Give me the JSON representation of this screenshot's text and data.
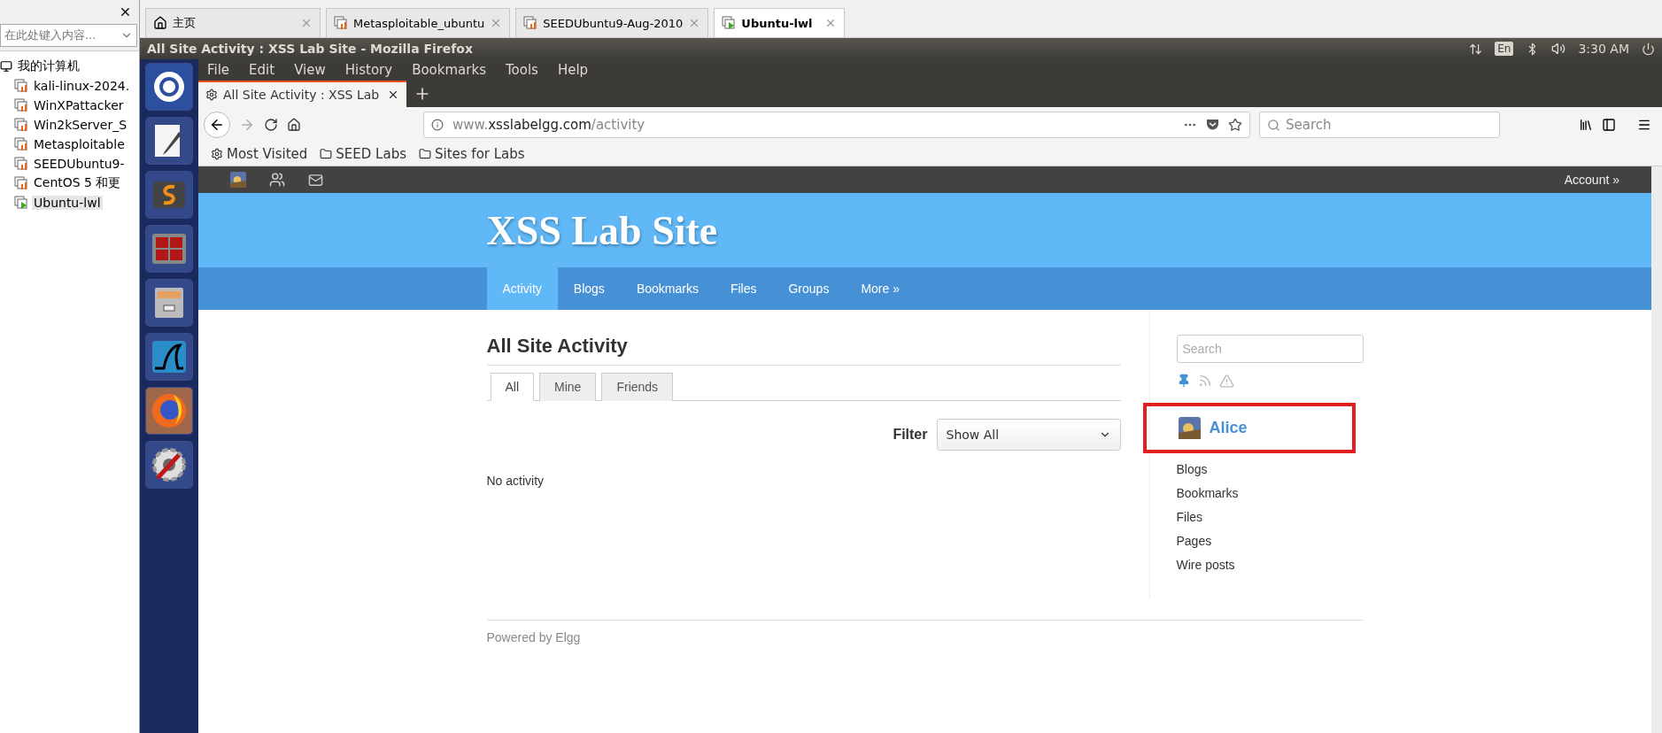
{
  "host_pane": {
    "search": {
      "placeholder": "在此处键入内容..."
    },
    "tree": [
      {
        "label": "我的计算机",
        "kind": "computer",
        "selected": false,
        "children": [
          {
            "label": "kali-linux-2024.",
            "kind": "vm",
            "running": false,
            "selected": false
          },
          {
            "label": "WinXPattacker",
            "kind": "vm",
            "running": false,
            "selected": false
          },
          {
            "label": "Win2kServer_S",
            "kind": "vm",
            "running": false,
            "selected": false
          },
          {
            "label": "Metasploitable",
            "kind": "vm",
            "running": false,
            "selected": false
          },
          {
            "label": "SEEDUbuntu9-",
            "kind": "vm",
            "running": false,
            "selected": false
          },
          {
            "label": "CentOS 5 和更",
            "kind": "vm",
            "running": false,
            "selected": false
          },
          {
            "label": "Ubuntu-lwl",
            "kind": "vm",
            "running": true,
            "selected": true
          }
        ]
      }
    ]
  },
  "vm_tabs": [
    {
      "label": "主页",
      "kind": "home",
      "selected": false
    },
    {
      "label": "Metasploitable_ubuntu",
      "kind": "vm",
      "running": false,
      "selected": false
    },
    {
      "label": "SEEDUbuntu9-Aug-2010",
      "kind": "vm",
      "running": false,
      "selected": false
    },
    {
      "label": "Ubuntu-lwl",
      "kind": "vm",
      "running": true,
      "selected": true
    }
  ],
  "top_panel": {
    "title": "All Site Activity : XSS Lab Site - Mozilla Firefox",
    "keyboard": "En",
    "clock": "3:30 AM"
  },
  "firefox": {
    "menu": [
      "File",
      "Edit",
      "View",
      "History",
      "Bookmarks",
      "Tools",
      "Help"
    ],
    "tab": {
      "title": "All Site Activity : XSS Lab",
      "selected": true
    },
    "url": {
      "prefix": "www.",
      "host": "xsslabelgg.com",
      "path": "/activity"
    },
    "search": {
      "placeholder": "Search"
    },
    "bookmarks": [
      {
        "label": "Most Visited",
        "kind": "gear"
      },
      {
        "label": "SEED Labs",
        "kind": "folder"
      },
      {
        "label": "Sites for Labs",
        "kind": "folder"
      }
    ]
  },
  "site": {
    "topbar": {
      "account": "Account »"
    },
    "title": "XSS Lab Site",
    "nav": [
      {
        "label": "Activity",
        "selected": true
      },
      {
        "label": "Blogs",
        "selected": false
      },
      {
        "label": "Bookmarks",
        "selected": false
      },
      {
        "label": "Files",
        "selected": false
      },
      {
        "label": "Groups",
        "selected": false
      },
      {
        "label": "More »",
        "selected": false
      }
    ],
    "heading": "All Site Activity",
    "tabs": [
      {
        "label": "All",
        "selected": true
      },
      {
        "label": "Mine",
        "selected": false
      },
      {
        "label": "Friends",
        "selected": false
      }
    ],
    "filter": {
      "label": "Filter",
      "value": "Show All"
    },
    "empty": "No activity",
    "sidebar": {
      "search": {
        "placeholder": "Search"
      },
      "owner": {
        "name": "Alice",
        "highlighted": true
      },
      "menu": [
        "Blogs",
        "Bookmarks",
        "Files",
        "Pages",
        "Wire posts"
      ]
    },
    "footer": "Powered by Elgg"
  }
}
